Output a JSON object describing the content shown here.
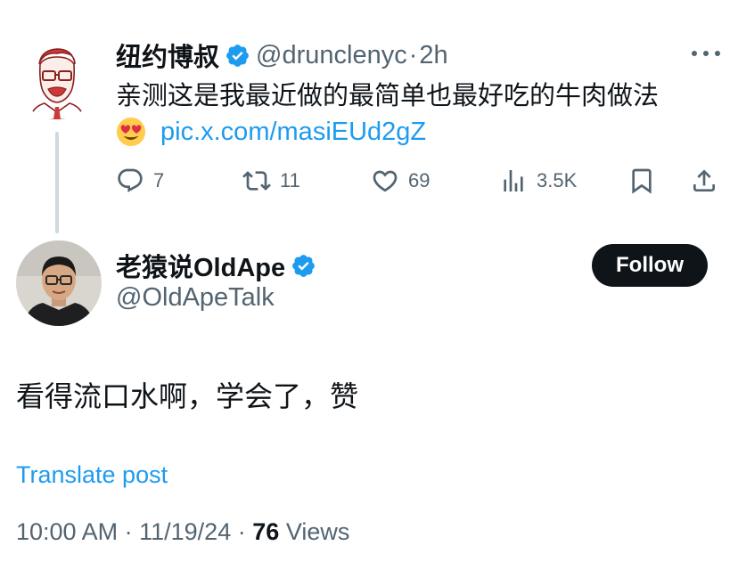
{
  "parent_post": {
    "author_name": "纽约博叔",
    "handle": "@drunclenyc",
    "separator": "·",
    "time": "2h",
    "text": "亲测这是我最近做的最简单也最好吃的牛肉做法",
    "link": "pic.x.com/masiEUd2gZ",
    "emoji": "smiling-face-with-heart-eyes",
    "actions": {
      "replies": "7",
      "reposts": "11",
      "likes": "69",
      "views": "3.5K"
    }
  },
  "reply_post": {
    "author_name": "老猿说OldApe",
    "handle": "@OldApeTalk",
    "follow_label": "Follow",
    "text": "看得流口水啊，学会了，赞",
    "translate_label": "Translate post",
    "time": "10:00 AM",
    "date": "11/19/24",
    "separator": "·",
    "views_count": "76",
    "views_label": "Views"
  },
  "colors": {
    "accent": "#1d9bf0",
    "text_primary": "#0f1419",
    "text_secondary": "#536471",
    "thread_line": "#cfd9de",
    "follow_bg": "#0f1419"
  }
}
